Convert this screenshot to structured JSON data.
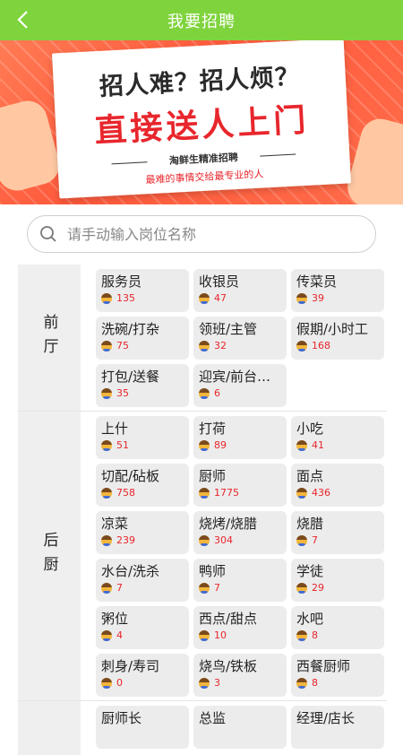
{
  "header": {
    "title": "我要招聘"
  },
  "banner": {
    "line1": "招人难？招人烦？",
    "line2": "直接送人上门",
    "line3": "淘鲜生精准招聘",
    "line4": "最难的事情交给最专业的人"
  },
  "search": {
    "placeholder": "请手动输入岗位名称"
  },
  "sections": [
    {
      "label": "前厅",
      "items": [
        {
          "name": "服务员",
          "count": "135"
        },
        {
          "name": "收银员",
          "count": "47"
        },
        {
          "name": "传菜员",
          "count": "39"
        },
        {
          "name": "洗碗/打杂",
          "count": "75"
        },
        {
          "name": "领班/主管",
          "count": "32"
        },
        {
          "name": "假期/小时工",
          "count": "168"
        },
        {
          "name": "打包/送餐",
          "count": "35"
        },
        {
          "name": "迎宾/前台…",
          "count": "6"
        }
      ]
    },
    {
      "label": "后厨",
      "items": [
        {
          "name": "上什",
          "count": "51"
        },
        {
          "name": "打荷",
          "count": "89"
        },
        {
          "name": "小吃",
          "count": "41"
        },
        {
          "name": "切配/砧板",
          "count": "758"
        },
        {
          "name": "厨师",
          "count": "1775"
        },
        {
          "name": "面点",
          "count": "436"
        },
        {
          "name": "凉菜",
          "count": "239"
        },
        {
          "name": "烧烤/烧腊",
          "count": "304"
        },
        {
          "name": "烧腊",
          "count": "7"
        },
        {
          "name": "水台/洗杀",
          "count": "7"
        },
        {
          "name": "鸭师",
          "count": "7"
        },
        {
          "name": "学徒",
          "count": "29"
        },
        {
          "name": "粥位",
          "count": "4"
        },
        {
          "name": "西点/甜点",
          "count": "10"
        },
        {
          "name": "水吧",
          "count": "8"
        },
        {
          "name": "刺身/寿司",
          "count": "0"
        },
        {
          "name": "烧鸟/铁板",
          "count": "3"
        },
        {
          "name": "西餐厨师",
          "count": "8"
        }
      ]
    },
    {
      "label": "",
      "items": [
        {
          "name": "厨师长",
          "count": ""
        },
        {
          "name": "总监",
          "count": ""
        },
        {
          "name": "经理/店长",
          "count": ""
        }
      ]
    }
  ],
  "colors": {
    "accent": "#7fd43d",
    "count_red": "#e8262c"
  }
}
